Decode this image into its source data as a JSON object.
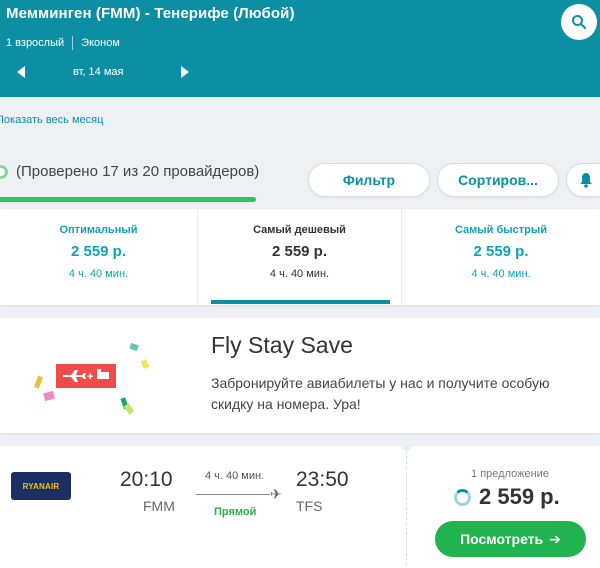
{
  "header": {
    "route_title": "Мемминген (FMM) - Тенерифе (Любой)",
    "passengers": "1 взрослый",
    "cabin_class": "Эконом",
    "date": "вт, 14 мая",
    "search_icon": "search-icon"
  },
  "month_link": "Показать весь месяц",
  "status": {
    "checked_text": "(Проверено 17 из 20 провайдеров)",
    "progress": 0.85
  },
  "actions": {
    "filter_label": "Фильтр",
    "sort_label": "Сортиров...",
    "bell_icon": "bell-icon"
  },
  "tabs": [
    {
      "title": "Оптимальный",
      "price": "2 559 р.",
      "time": "4 ч. 40 мин."
    },
    {
      "title": "Самый дешевый",
      "price": "2 559 р.",
      "time": "4 ч. 40 мин."
    },
    {
      "title": "Самый быстрый",
      "price": "2 559 р.",
      "time": "4 ч. 40 мин."
    }
  ],
  "promo": {
    "title": "Fly Stay Save",
    "text": "Забронируйте авиабилеты у нас и получите особую скидку на номера. Ура!"
  },
  "flight": {
    "airline": "RYANAIR",
    "departure_time": "20:10",
    "departure_code": "FMM",
    "arrival_time": "23:50",
    "arrival_code": "TFS",
    "duration": "4 ч. 40 мин.",
    "stops": "Прямой",
    "offer_count": "1 предложение",
    "price": "2 559 р.",
    "view_label": "Посмотреть"
  },
  "colors": {
    "header_bg": "#0d8fa3",
    "accent": "#10a3b5",
    "green": "#21b34f",
    "airline_bg": "#1c2f63",
    "airline_text": "#f5c400"
  }
}
